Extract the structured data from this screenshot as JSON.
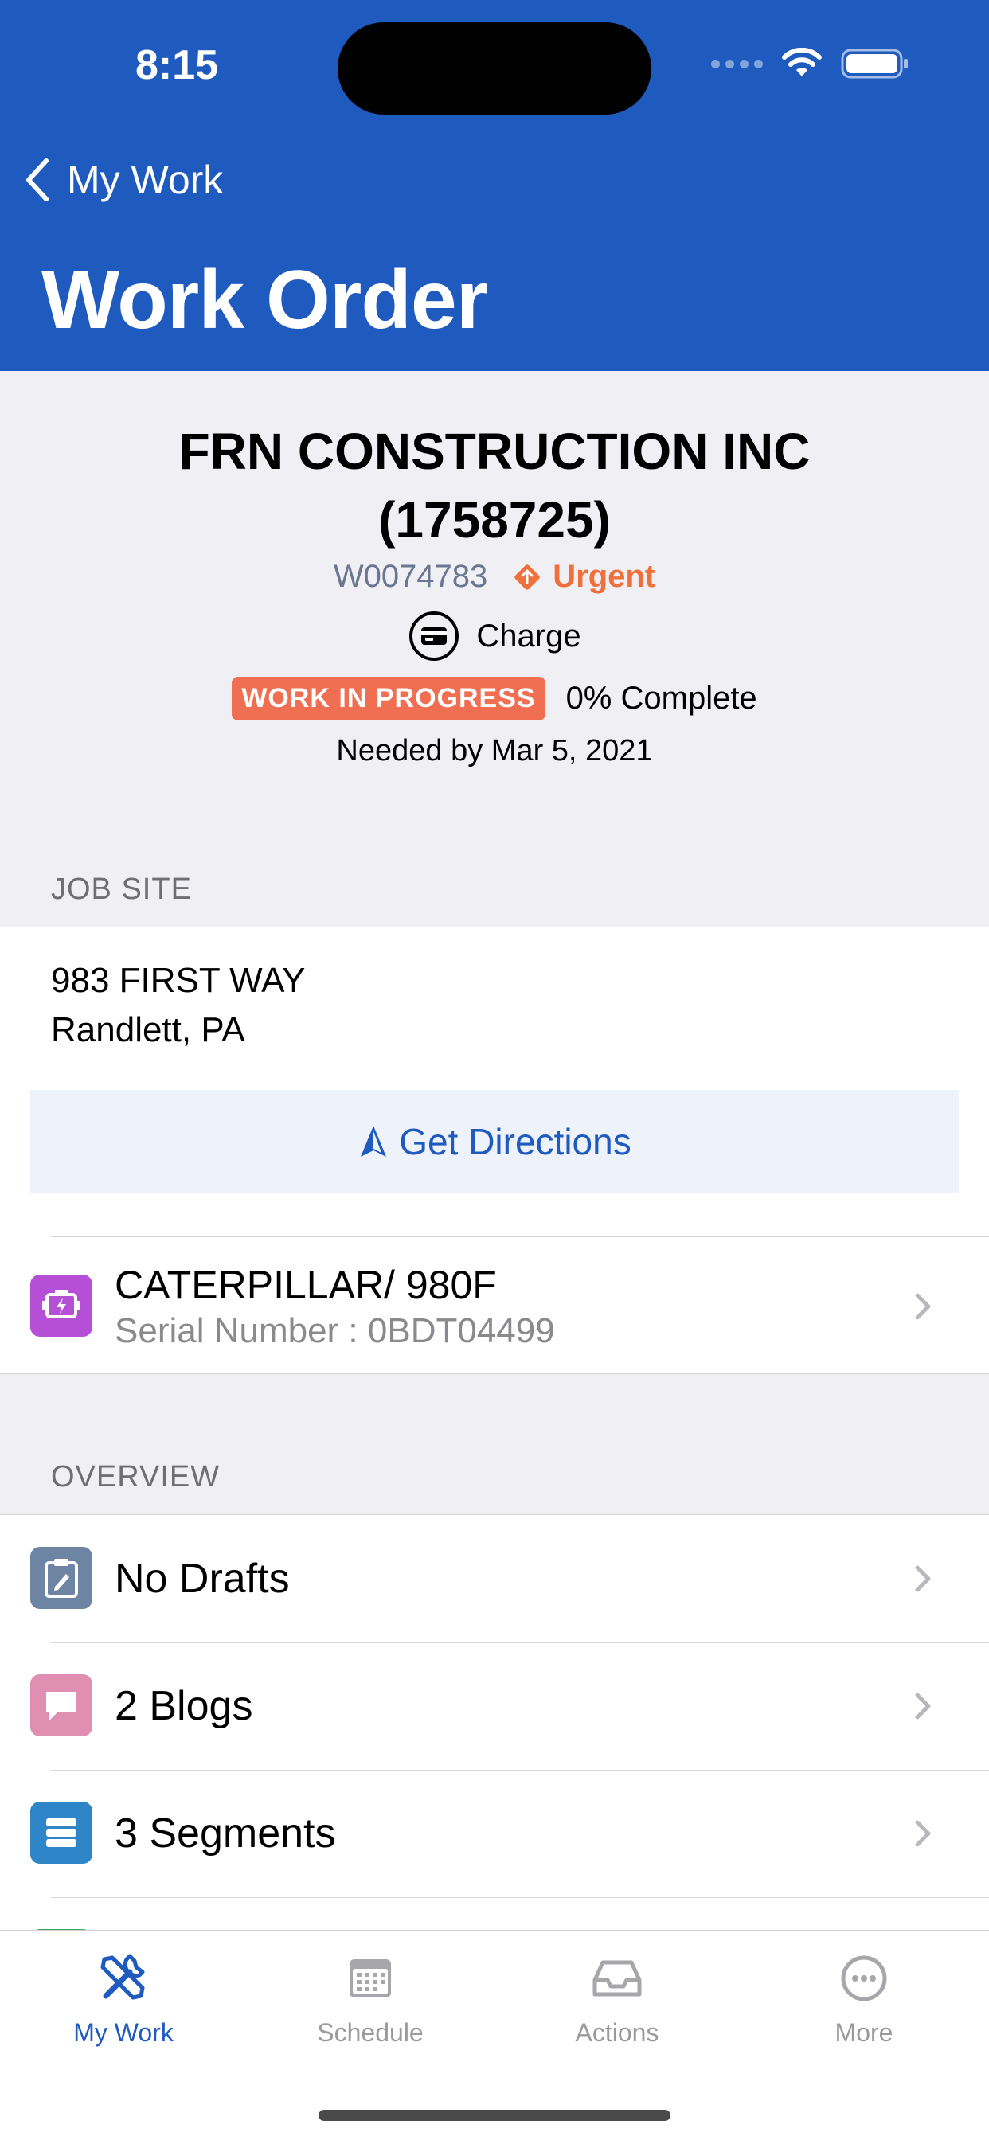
{
  "status_bar": {
    "time": "8:15"
  },
  "header": {
    "back_label": "My Work",
    "title": "Work Order"
  },
  "summary": {
    "customer_line1": "FRN CONSTRUCTION INC",
    "customer_line2": "(1758725)",
    "wo_number": "W0074783",
    "priority": "Urgent",
    "billing": "Charge",
    "status": "WORK IN PROGRESS",
    "progress": "0% Complete",
    "needed_by": "Needed by Mar 5, 2021"
  },
  "job_site": {
    "section_label": "JOB SITE",
    "address_line1": "983 FIRST WAY",
    "address_line2": "Randlett, PA",
    "directions_label": "Get Directions"
  },
  "equipment": {
    "name": "CATERPILLAR/ 980F",
    "serial": "Serial Number : 0BDT04499"
  },
  "overview": {
    "section_label": "OVERVIEW",
    "items": [
      {
        "label": "No Drafts",
        "icon": "clipboard-edit-icon",
        "color": "#6e84a3"
      },
      {
        "label": "2 Blogs",
        "icon": "chat-bubble-icon",
        "color": "#e08fb2"
      },
      {
        "label": "3 Segments",
        "icon": "list-stack-icon",
        "color": "#2e86c8"
      }
    ]
  },
  "tabs": [
    {
      "label": "My Work",
      "icon": "tools-icon",
      "active": true
    },
    {
      "label": "Schedule",
      "icon": "calendar-icon",
      "active": false
    },
    {
      "label": "Actions",
      "icon": "inbox-icon",
      "active": false
    },
    {
      "label": "More",
      "icon": "more-icon",
      "active": false
    }
  ],
  "colors": {
    "brand": "#1f5bbf",
    "urgent": "#f0703c",
    "status": "#f06f52"
  }
}
